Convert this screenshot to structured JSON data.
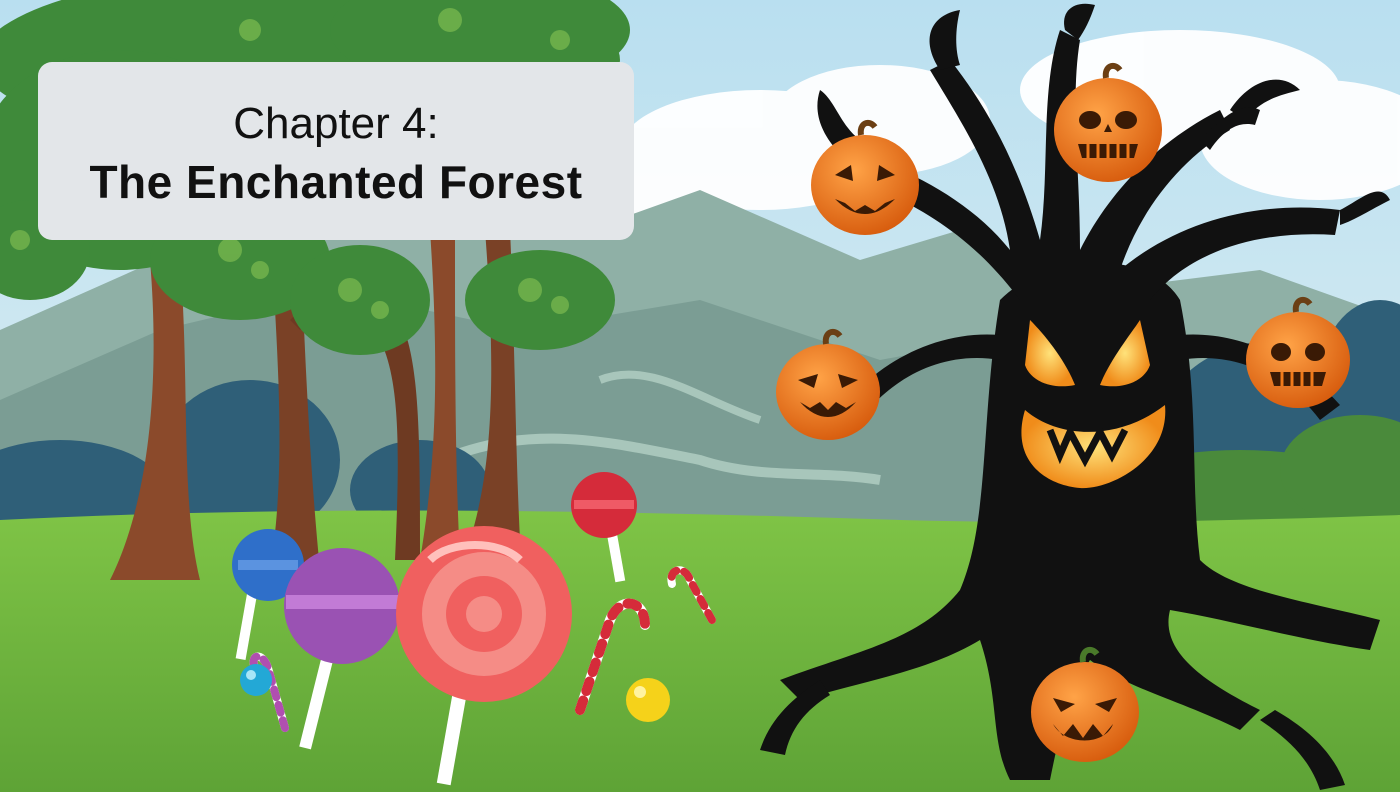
{
  "title_card": {
    "chapter": "Chapter 4:",
    "name": "The Enchanted Forest"
  },
  "colors": {
    "sky": "#cfe9f2",
    "mountain": "#8aa9a0",
    "grass": "#7cc243",
    "tree_trunk": "#8b4a2b",
    "foliage": "#3f8a3a",
    "spooky_tree": "#111111",
    "pumpkin": "#f07a1a",
    "glow": "#f5a623",
    "title_bg": "#e3e6e9"
  },
  "scene_elements": {
    "forest_trees": "forest-tree-icon",
    "lollipops": "lollipop-icon",
    "candy_canes": "candy-cane-icon",
    "gumballs": "gumball-icon",
    "spooky_tree": "spooky-tree-icon",
    "jack_o_lanterns": "jack-o-lantern-icon"
  }
}
